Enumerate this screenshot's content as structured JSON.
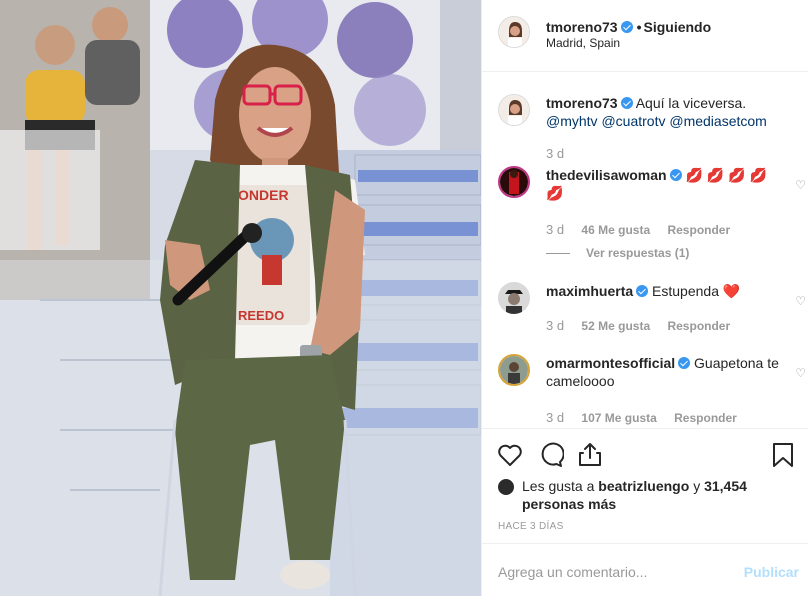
{
  "post": {
    "username": "tmoreno73",
    "following_label": "Siguiendo",
    "location": "Madrid, Spain"
  },
  "caption": {
    "username": "tmoreno73",
    "text": "Aquí la viceversa.",
    "mentions": [
      "@myhtv",
      "@cuatrotv",
      "@mediasetcom"
    ],
    "time": "3 d"
  },
  "comments": [
    {
      "username": "thedevilisawoman",
      "text": "💋 💋 💋 💋 💋",
      "time": "3 d",
      "likes": "46 Me gusta",
      "reply_label": "Responder",
      "view_replies": "Ver respuestas (1)"
    },
    {
      "username": "maximhuerta",
      "text": "Estupenda ❤️",
      "time": "3 d",
      "likes": "52 Me gusta",
      "reply_label": "Responder"
    },
    {
      "username": "omarmontesofficial",
      "text": "Guapetona te cameloooo",
      "time": "3 d",
      "likes": "107 Me gusta",
      "reply_label": "Responder"
    }
  ],
  "likes": {
    "prefix": "Les gusta a",
    "user": "beatrizluengo",
    "connector": "y",
    "others": "31,454 personas más"
  },
  "timestamp": "HACE 3 DÍAS",
  "add_comment": {
    "placeholder": "Agrega un comentario...",
    "publish_label": "Publicar"
  },
  "icons": [
    "verified-icon",
    "heart-icon",
    "comment-icon",
    "share-icon",
    "bookmark-icon"
  ],
  "colors": {
    "link": "#003569",
    "verified": "#3897f0",
    "publish_disabled": "#b2dffc",
    "muted": "#999999"
  }
}
